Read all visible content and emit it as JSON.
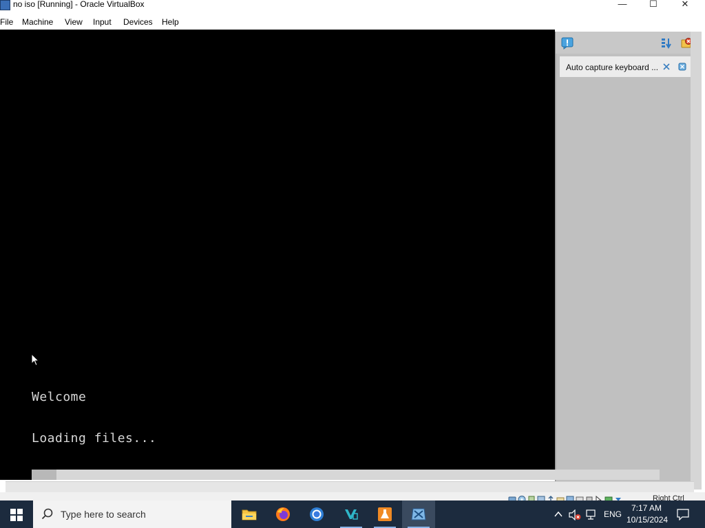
{
  "window": {
    "title": "no iso [Running] - Oracle VirtualBox",
    "controls": {
      "minimize": "—",
      "maximize": "☐",
      "close": "✕"
    }
  },
  "menu": {
    "items": [
      "File",
      "Machine",
      "View",
      "Input",
      "Devices",
      "Help"
    ]
  },
  "vm_screen": {
    "lines": [
      "Welcome",
      "Loading files..."
    ]
  },
  "side_panel": {
    "notice": "Auto capture keyboard ..."
  },
  "statusbar": {
    "host_key": "Right Ctrl"
  },
  "taskbar": {
    "search_placeholder": "Type here to search",
    "apps": [
      "file-explorer-icon",
      "firefox-icon",
      "chrome-icon",
      "visual-studio-icon",
      "lab-flask-icon",
      "virtualbox-icon"
    ],
    "language": "ENG",
    "time": "7:17 AM",
    "date": "10/15/2024"
  },
  "colors": {
    "taskbar_bg": "#1c2b3e",
    "vm_bg": "#000000",
    "panel_bg": "#c0c0c0",
    "accent": "#3b82f6"
  }
}
